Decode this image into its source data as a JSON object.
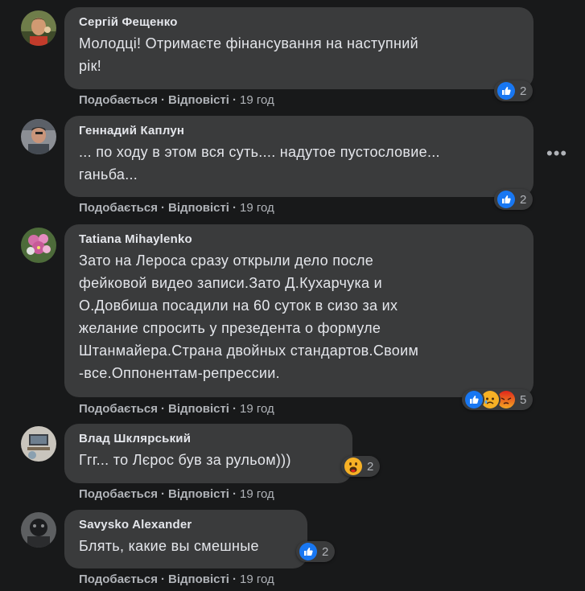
{
  "actions": {
    "like": "Подобається",
    "reply": "Відповісті",
    "separator": "·"
  },
  "comments": [
    {
      "author": "Сергій Фещенко",
      "lines": [
        "Молодці! Отримаєте фінансування на наступний",
        "рік!"
      ],
      "time": "19 год",
      "reactions": {
        "icons": [
          "like-reaction-icon"
        ],
        "count": "2"
      }
    },
    {
      "author": "Геннадий Каплун",
      "lines": [
        "... по ходу в этом вся суть.... надутое пустословие...",
        "ганьба..."
      ],
      "time": "19 год",
      "reactions": {
        "icons": [
          "like-reaction-icon"
        ],
        "count": "2"
      }
    },
    {
      "author": "Tatiana Mihaylenko",
      "lines": [
        "Зато на Лероса сразу открыли дело после",
        "фейковой видео записи.Зато Д.Кухарчука и",
        "О.Довбиша посадили на 60 суток в сизо за их",
        "желание спросить у презедента о формуле",
        "Штанмайера.Страна двойных стандартов.Своим",
        "-все.Оппонентам-репрессии."
      ],
      "time": "19 год",
      "reactions": {
        "icons": [
          "like-reaction-icon",
          "sad-reaction-icon",
          "angry-reaction-icon"
        ],
        "count": "5"
      }
    },
    {
      "author": "Влад Шклярський",
      "lines": [
        "Ггг... то Лєрос був за рульом)))"
      ],
      "time": "19 год",
      "reactions": {
        "icons": [
          "wow-reaction-icon"
        ],
        "count": "2"
      }
    },
    {
      "author": "Savysko Alexander",
      "lines": [
        "Блять, какие вы смешные"
      ],
      "time": "19 год",
      "reactions": {
        "icons": [
          "like-reaction-icon"
        ],
        "count": "2"
      }
    }
  ],
  "more_menu": "•••",
  "colors": {
    "background": "#18191a",
    "bubble": "#3a3b3c",
    "text": "#e4e6eb",
    "secondary": "#b0b3b8",
    "like": "#1877f2",
    "angry": "#e9710f",
    "haha": "#f7b125"
  }
}
